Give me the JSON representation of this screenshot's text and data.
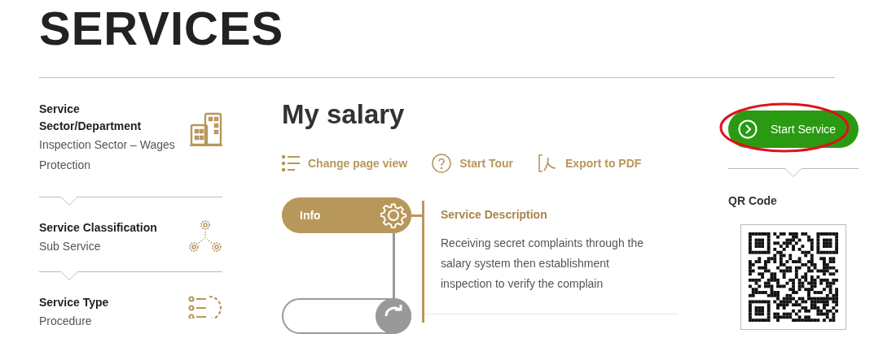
{
  "page_title": "SERVICES",
  "details": [
    {
      "label": "Service Sector/Department",
      "value": "Inspection Sector – Wages Protection",
      "kind": "building"
    },
    {
      "label": "Service Classification",
      "value": "Sub Service",
      "kind": "gears"
    },
    {
      "label": "Service Type",
      "value": "Procedure",
      "kind": "list-gear"
    }
  ],
  "service": {
    "title": "My salary",
    "actions": [
      {
        "label": "Change page view",
        "kind": "list"
      },
      {
        "label": "Start Tour",
        "kind": "help"
      },
      {
        "label": "Export to PDF",
        "kind": "pdf"
      }
    ],
    "steps": [
      {
        "label": "Info",
        "selected": true,
        "kind": "gear"
      },
      {
        "selected": false,
        "kind": "refresh"
      }
    ],
    "section": {
      "title": "Service Description",
      "text": "Receiving secret complaints through the salary system then establishment inspection to verify the complain"
    }
  },
  "side": {
    "button": "Start Service",
    "qr_label": "QR Code"
  }
}
